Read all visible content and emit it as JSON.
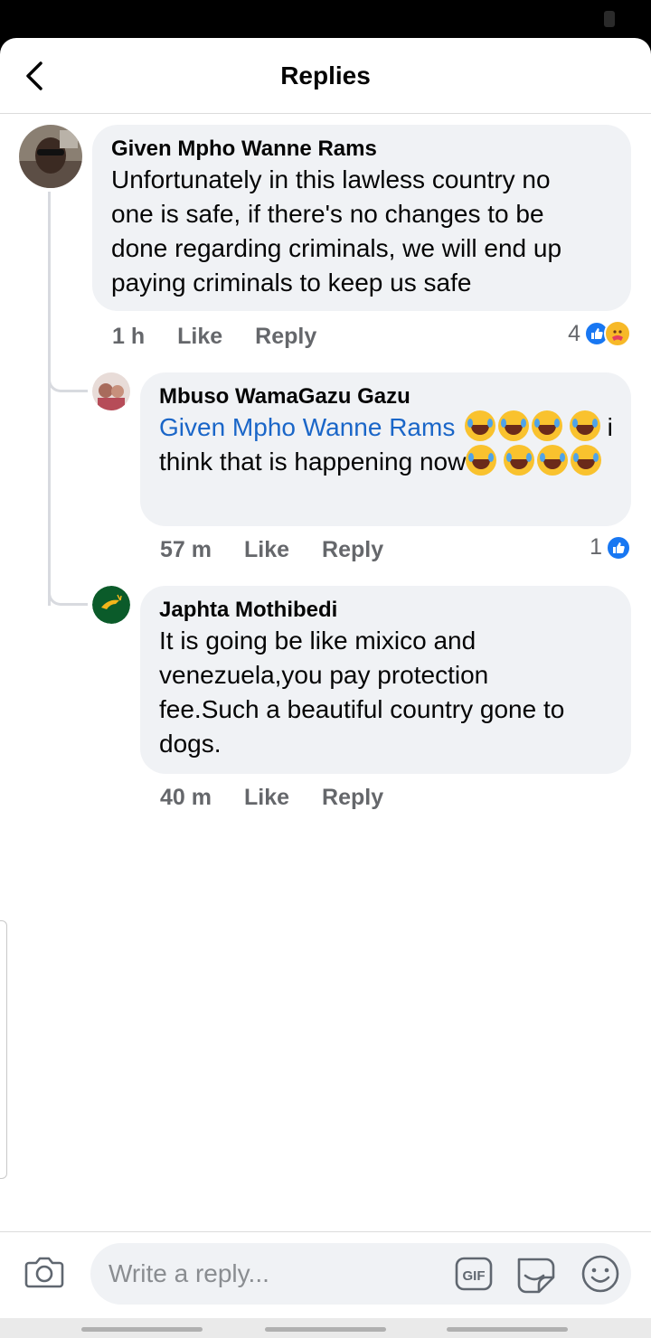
{
  "header": {
    "title": "Replies"
  },
  "comments": [
    {
      "author": "Given Mpho Wanne Rams",
      "lines": [
        "Unfortunately in this lawless country no",
        "one is safe, if there's no changes to be",
        "done regarding criminals, we will end up",
        "paying criminals to keep us safe"
      ],
      "age": "1 h",
      "like_label": "Like",
      "reply_label": "Reply",
      "reaction_count": "4"
    },
    {
      "author": "Mbuso WamaGazu Gazu",
      "mention": "Given Mpho Wanne Rams",
      "body": "i think that is happening now",
      "age": "57 m",
      "like_label": "Like",
      "reply_label": "Reply",
      "reaction_count": "1"
    },
    {
      "author": "Japhta Mothibedi",
      "lines": [
        "It is going be like mixico and",
        "venezuela,you pay protection",
        "fee.Such a beautiful country gone to",
        "dogs."
      ],
      "age": "40 m",
      "like_label": "Like",
      "reply_label": "Reply"
    }
  ],
  "composer": {
    "placeholder": "Write a reply...",
    "gif_label": "GIF"
  },
  "colors": {
    "accent": "#1877f2",
    "mention": "#1a66c8",
    "bubble": "#f0f2f5",
    "meta": "#65676b"
  },
  "icons": [
    "chevron-left-icon",
    "like-reaction-icon",
    "care-reaction-icon",
    "laughing-emoji-icon",
    "camera-icon",
    "gif-icon",
    "sticker-icon",
    "smiley-icon"
  ]
}
